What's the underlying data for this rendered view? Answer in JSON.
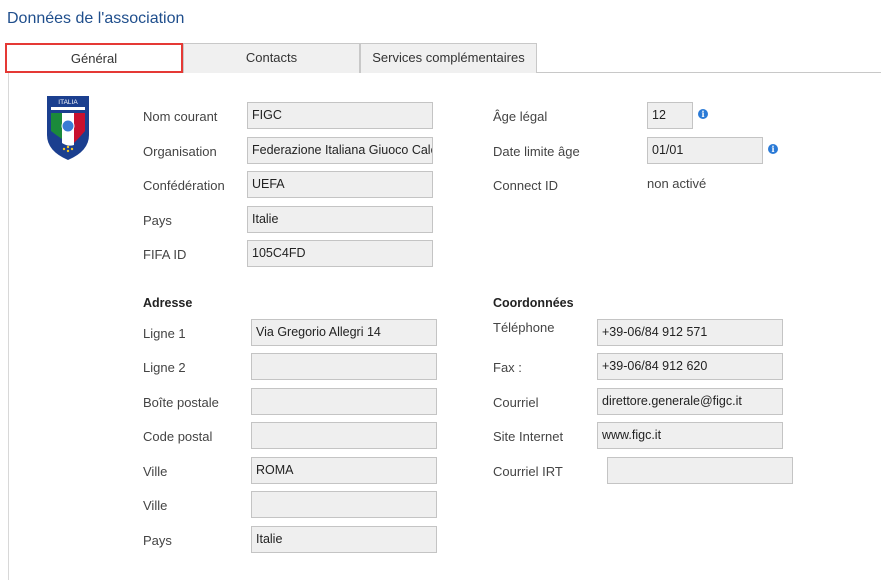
{
  "page": {
    "title": "Données de l'association"
  },
  "tabs": [
    {
      "label": "Général",
      "active": true
    },
    {
      "label": "Contacts",
      "active": false
    },
    {
      "label": "Services complémentaires",
      "active": false
    }
  ],
  "logo": {
    "text": "ITALIA",
    "icon": "figc-crest-icon"
  },
  "general": {
    "nom_courant": {
      "label": "Nom courant",
      "value": "FIGC"
    },
    "organisation": {
      "label": "Organisation",
      "value": "Federazione Italiana Giuoco Calcio"
    },
    "confederation": {
      "label": "Confédération",
      "value": "UEFA"
    },
    "pays": {
      "label": "Pays",
      "value": "Italie"
    },
    "fifa_id": {
      "label": "FIFA ID",
      "value": "105C4FD"
    },
    "age_legal": {
      "label": "Âge légal",
      "value": "12"
    },
    "date_limite": {
      "label": "Date limite âge",
      "value": "01/01"
    },
    "connect_id": {
      "label": "Connect ID",
      "value": "non activé"
    }
  },
  "adresse": {
    "heading": "Adresse",
    "ligne1": {
      "label": "Ligne 1",
      "value": "Via Gregorio Allegri 14"
    },
    "ligne2": {
      "label": "Ligne 2",
      "value": ""
    },
    "boite_postale": {
      "label": "Boîte postale",
      "value": ""
    },
    "code_postal": {
      "label": "Code postal",
      "value": ""
    },
    "ville1": {
      "label": "Ville",
      "value": "ROMA"
    },
    "ville2": {
      "label": "Ville",
      "value": ""
    },
    "pays": {
      "label": "Pays",
      "value": "Italie"
    }
  },
  "coordonnees": {
    "heading": "Coordonnées",
    "telephone": {
      "label": "Téléphone",
      "value": "+39-06/84 912 571"
    },
    "fax": {
      "label": "Fax :",
      "value": "+39-06/84 912 620"
    },
    "courriel": {
      "label": "Courriel",
      "value": "direttore.generale@figc.it"
    },
    "site": {
      "label": "Site Internet",
      "value": "www.figc.it"
    },
    "courriel_irt": {
      "label": "Courriel IRT",
      "value": ""
    }
  },
  "colors": {
    "accent": "#1f4e8c",
    "active_tab_border": "#e53935",
    "info_icon": "#2a7ad6"
  }
}
